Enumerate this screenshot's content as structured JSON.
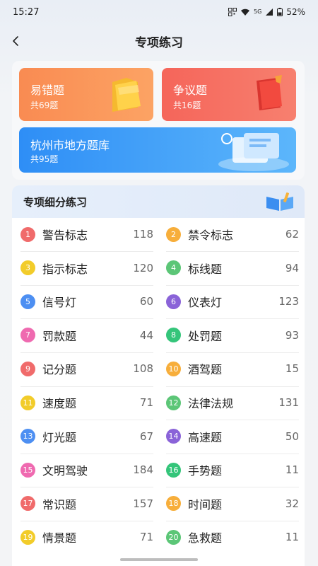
{
  "status_bar": {
    "time": "15:27",
    "battery": "52%",
    "network": "5G"
  },
  "header": {
    "title": "专项练习"
  },
  "cards": {
    "error_prone": {
      "title": "易错题",
      "count": "共69题"
    },
    "disputed": {
      "title": "争议题",
      "count": "共16题"
    },
    "local": {
      "title": "杭州市地方题库",
      "count": "共95题"
    }
  },
  "section": {
    "title": "专项细分练习"
  },
  "items": [
    {
      "num": "1",
      "label": "警告标志",
      "count": "118",
      "color": "#f06b6b"
    },
    {
      "num": "2",
      "label": "禁令标志",
      "count": "62",
      "color": "#f7ae3b"
    },
    {
      "num": "3",
      "label": "指示标志",
      "count": "120",
      "color": "#f2cc2a"
    },
    {
      "num": "4",
      "label": "标线题",
      "count": "94",
      "color": "#5cc677"
    },
    {
      "num": "5",
      "label": "信号灯",
      "count": "60",
      "color": "#4d8ff2"
    },
    {
      "num": "6",
      "label": "仪表灯",
      "count": "123",
      "color": "#8a63d8"
    },
    {
      "num": "7",
      "label": "罚款题",
      "count": "44",
      "color": "#ef6ab0"
    },
    {
      "num": "8",
      "label": "处罚题",
      "count": "93",
      "color": "#34c57a"
    },
    {
      "num": "9",
      "label": "记分题",
      "count": "108",
      "color": "#f06b6b"
    },
    {
      "num": "10",
      "label": "酒驾题",
      "count": "15",
      "color": "#f7ae3b"
    },
    {
      "num": "11",
      "label": "速度题",
      "count": "71",
      "color": "#f2cc2a"
    },
    {
      "num": "12",
      "label": "法律法规",
      "count": "131",
      "color": "#5cc677"
    },
    {
      "num": "13",
      "label": "灯光题",
      "count": "67",
      "color": "#4d8ff2"
    },
    {
      "num": "14",
      "label": "高速题",
      "count": "50",
      "color": "#8a63d8"
    },
    {
      "num": "15",
      "label": "文明驾驶",
      "count": "184",
      "color": "#ef6ab0"
    },
    {
      "num": "16",
      "label": "手势题",
      "count": "11",
      "color": "#34c57a"
    },
    {
      "num": "17",
      "label": "常识题",
      "count": "157",
      "color": "#f06b6b"
    },
    {
      "num": "18",
      "label": "时间题",
      "count": "32",
      "color": "#f7ae3b"
    },
    {
      "num": "19",
      "label": "情景题",
      "count": "71",
      "color": "#f2cc2a"
    },
    {
      "num": "20",
      "label": "急救题",
      "count": "11",
      "color": "#5cc677"
    }
  ]
}
